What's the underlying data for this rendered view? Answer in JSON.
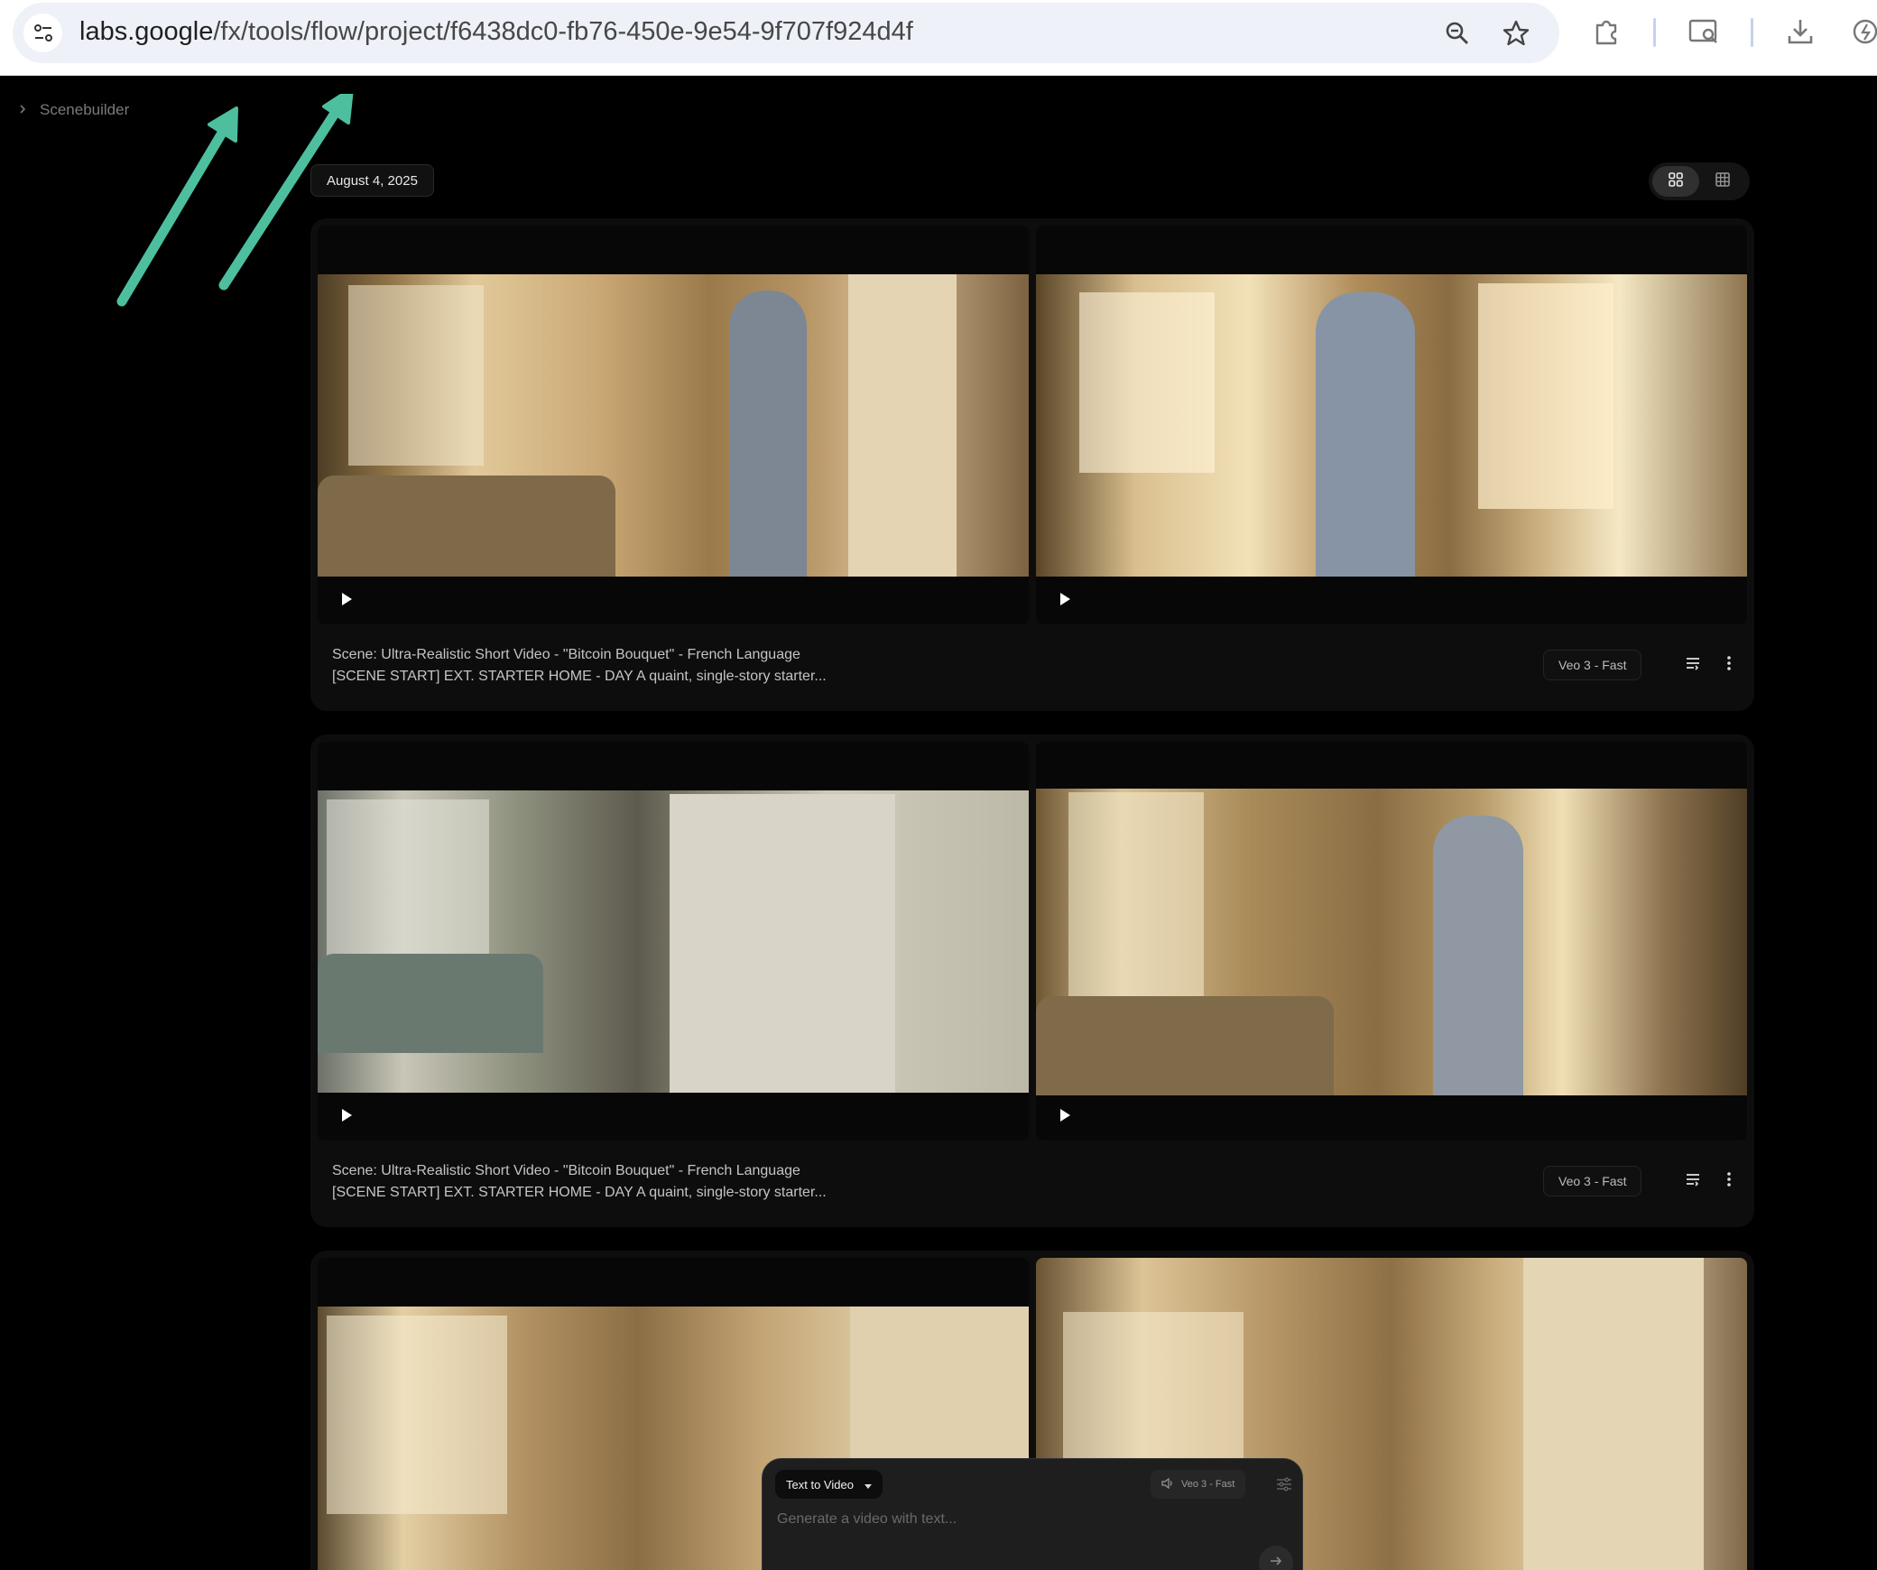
{
  "browser": {
    "url_host": "labs.google",
    "url_path": "/fx/tools/flow/project/f6438dc0-fb76-450e-9e54-9f707f924d4f",
    "icons": [
      "site-settings-icon",
      "zoom-icon",
      "bookmark-star-icon",
      "extensions-icon",
      "page-search-icon",
      "download-icon",
      "sync-icon"
    ]
  },
  "sidebar": {
    "breadcrumb_label": "Scenebuilder"
  },
  "toolbar": {
    "date": "August 4, 2025"
  },
  "scenes": [
    {
      "prompt_line1": "Scene: Ultra-Realistic Short Video - \"Bitcoin Bouquet\" - French Language",
      "prompt_line2": "[SCENE START] EXT. STARTER HOME - DAY A quaint, single-story starter...",
      "model": "Veo 3 - Fast"
    },
    {
      "prompt_line1": "Scene: Ultra-Realistic Short Video - \"Bitcoin Bouquet\" - French Language",
      "prompt_line2": "[SCENE START] EXT. STARTER HOME - DAY A quaint, single-story starter...",
      "model": "Veo 3 - Fast"
    }
  ],
  "composer": {
    "mode": "Text to Video",
    "model": "Veo 3 - Fast",
    "placeholder": "Generate a video with text..."
  },
  "colors": {
    "arrow": "#4dbf9f",
    "background": "#000000",
    "card": "#0d0d0d"
  }
}
